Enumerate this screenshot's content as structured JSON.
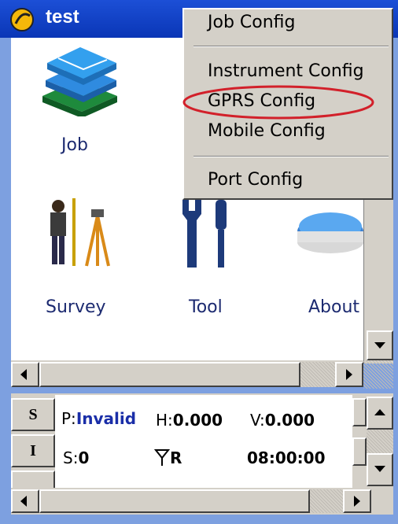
{
  "window": {
    "title": "test"
  },
  "icons": [
    {
      "label": "Job",
      "icon": "books-icon"
    },
    {
      "label": "Survey",
      "icon": "surveyor-icon"
    },
    {
      "label": "Tool",
      "icon": "tools-icon"
    },
    {
      "label": "About",
      "icon": "gps-receiver-icon"
    }
  ],
  "status": {
    "btn_s": "S",
    "btn_i": "I",
    "p_label": "P:",
    "p_value": "Invalid",
    "h_label": "H:",
    "h_value": "0.000",
    "v_label": "V:",
    "v_value": "0.000",
    "s_label": "S:",
    "s_value": "0",
    "r_label": "R",
    "time": "08:00:00",
    "p_color": "#1a2ea8"
  },
  "menu": {
    "items": [
      "Job Config",
      "Instrument Config",
      "GPRS Config",
      "Mobile Config",
      "Port Config"
    ],
    "highlight_color": "#d2202a"
  }
}
